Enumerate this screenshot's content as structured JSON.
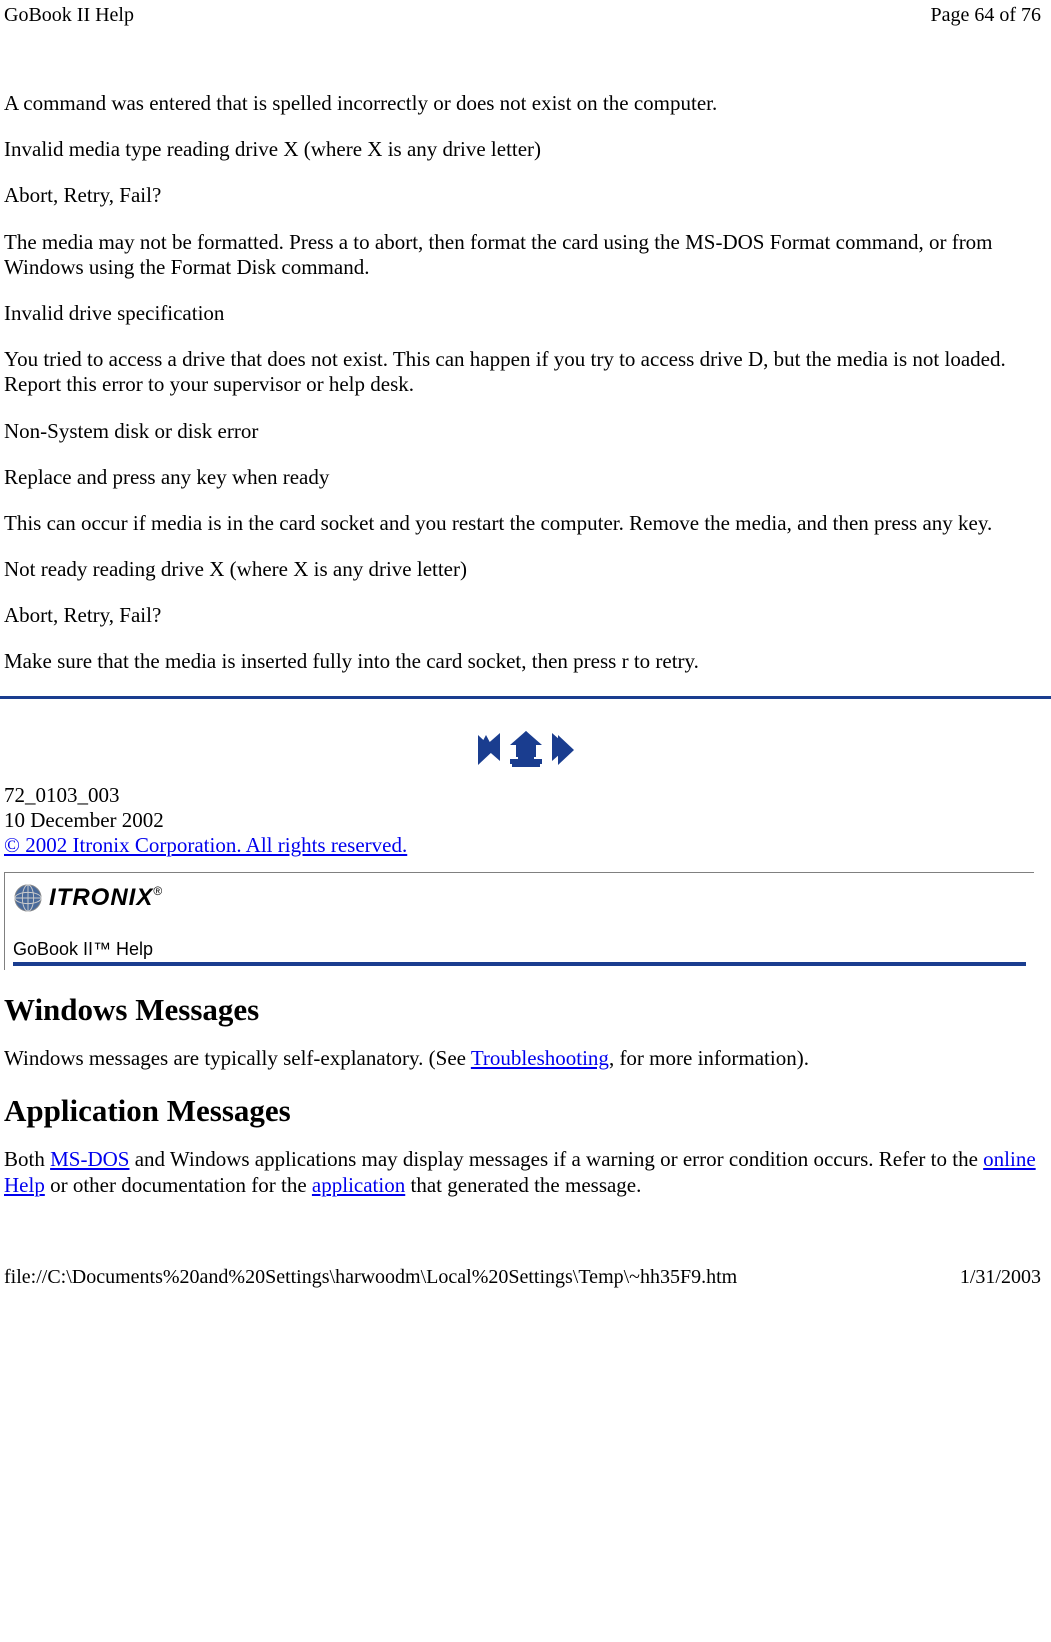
{
  "header": {
    "title": "GoBook II Help",
    "page_info": "Page 64 of 76"
  },
  "paragraphs": {
    "p1": "A command was entered that is spelled incorrectly or does not exist on the computer.",
    "p2": "Invalid media type reading drive X (where X is any drive letter)",
    "p3": "Abort, Retry, Fail?",
    "p4": "The media may not be formatted. Press a to abort, then format the card using the MS-DOS Format command, or from Windows using the Format Disk command.",
    "p5": "Invalid drive specification",
    "p6": "You tried to access a drive that does not exist. This can happen if you try to access drive D, but the media is not loaded. Report this error to your supervisor or help desk.",
    "p7": "Non-System disk or disk error",
    "p8": "Replace and press any key when ready",
    "p9": "This can occur if media is in the card socket and you restart the computer. Remove the media, and then press any key.",
    "p10": "Not ready reading drive X (where X is any drive letter)",
    "p11": "Abort, Retry, Fail?",
    "p12": "Make sure that the media is inserted fully into the card socket, then press r to retry."
  },
  "meta": {
    "doc_id": "72_0103_003",
    "date": "10 December 2002",
    "copyright": "© 2002 Itronix Corporation.  All rights reserved."
  },
  "logo": {
    "brand": "ITRONIX",
    "product": "GoBook II™ Help"
  },
  "headings": {
    "h1": "Windows Messages",
    "h2": "Application Messages"
  },
  "body": {
    "win_pre": "Windows messages are typically self-explanatory. (See ",
    "win_link": "Troubleshooting",
    "win_post": ", for more information).",
    "app_pre": "Both ",
    "app_link1": "MS-DOS",
    "app_mid1": " and Windows applications may display messages if a warning or error condition occurs. Refer to the ",
    "app_link2": "online Help",
    "app_mid2": " or other documentation for the ",
    "app_link3": "application",
    "app_post": " that generated the message."
  },
  "footer": {
    "path": "file://C:\\Documents%20and%20Settings\\harwoodm\\Local%20Settings\\Temp\\~hh35F9.htm",
    "date": "1/31/2003"
  }
}
